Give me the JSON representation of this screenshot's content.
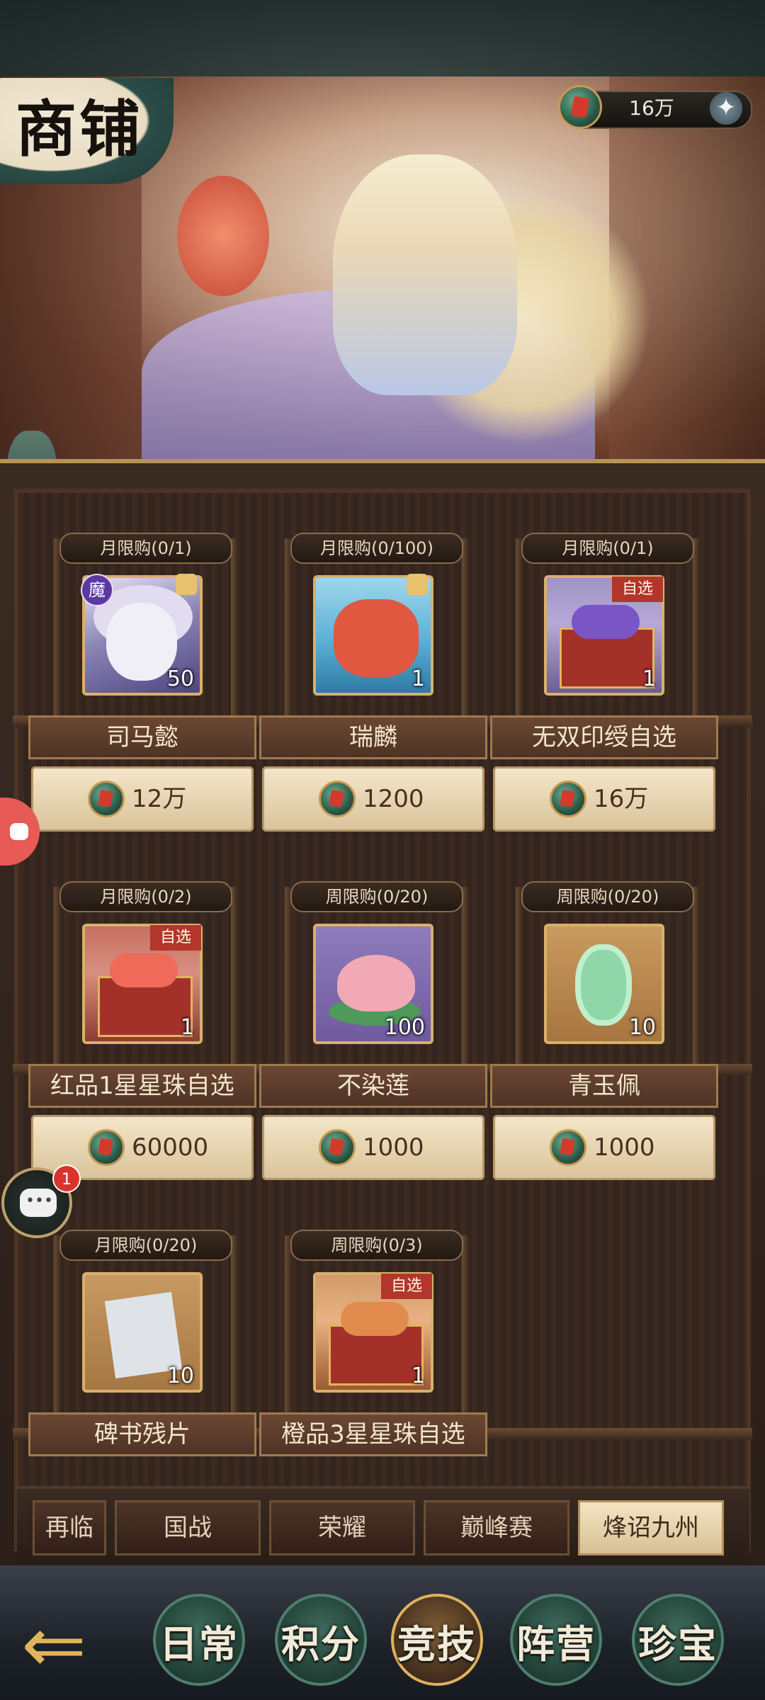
{
  "header": {
    "title": "商铺",
    "currency": {
      "icon": "jade-token-icon",
      "amount": "16万"
    }
  },
  "items": [
    {
      "limit": "月限购(0/1)",
      "name": "司马懿",
      "qty": "50",
      "price": "12万",
      "badge": "魔",
      "icon": "hero-portrait-icon"
    },
    {
      "limit": "月限购(0/100)",
      "name": "瑞麟",
      "qty": "1",
      "price": "1200",
      "icon": "dragon-mount-icon"
    },
    {
      "limit": "月限购(0/1)",
      "name": "无双印绶自选",
      "qty": "1",
      "price": "16万",
      "ribbon": "自选",
      "icon": "purple-chest-icon"
    },
    {
      "limit": "月限购(0/2)",
      "name": "红品1星星珠自选",
      "qty": "1",
      "price": "60000",
      "ribbon": "自选",
      "icon": "red-chest-icon"
    },
    {
      "limit": "周限购(0/20)",
      "name": "不染莲",
      "qty": "100",
      "price": "1000",
      "icon": "lotus-icon"
    },
    {
      "limit": "周限购(0/20)",
      "name": "青玉佩",
      "qty": "10",
      "price": "1000",
      "icon": "jade-pendant-icon"
    },
    {
      "limit": "月限购(0/20)",
      "name": "碑书残片",
      "qty": "10",
      "icon": "stone-fragment-icon"
    },
    {
      "limit": "周限购(0/3)",
      "name": "橙品3星星珠自选",
      "qty": "1",
      "ribbon": "自选",
      "icon": "orange-chest-icon"
    }
  ],
  "sub_tabs": [
    "再临",
    "国战",
    "荣耀",
    "巅峰赛",
    "烽诏九州"
  ],
  "sub_tab_active": "烽诏九州",
  "main_tabs": [
    "日常",
    "积分",
    "竞技",
    "阵营",
    "珍宝"
  ],
  "main_tab_active": "竞技",
  "chat": {
    "badge_count": "1"
  },
  "colors": {
    "accent_gold": "#d8b06a",
    "active_tab": "#f3e4c2",
    "badge_red": "#d9342c"
  }
}
